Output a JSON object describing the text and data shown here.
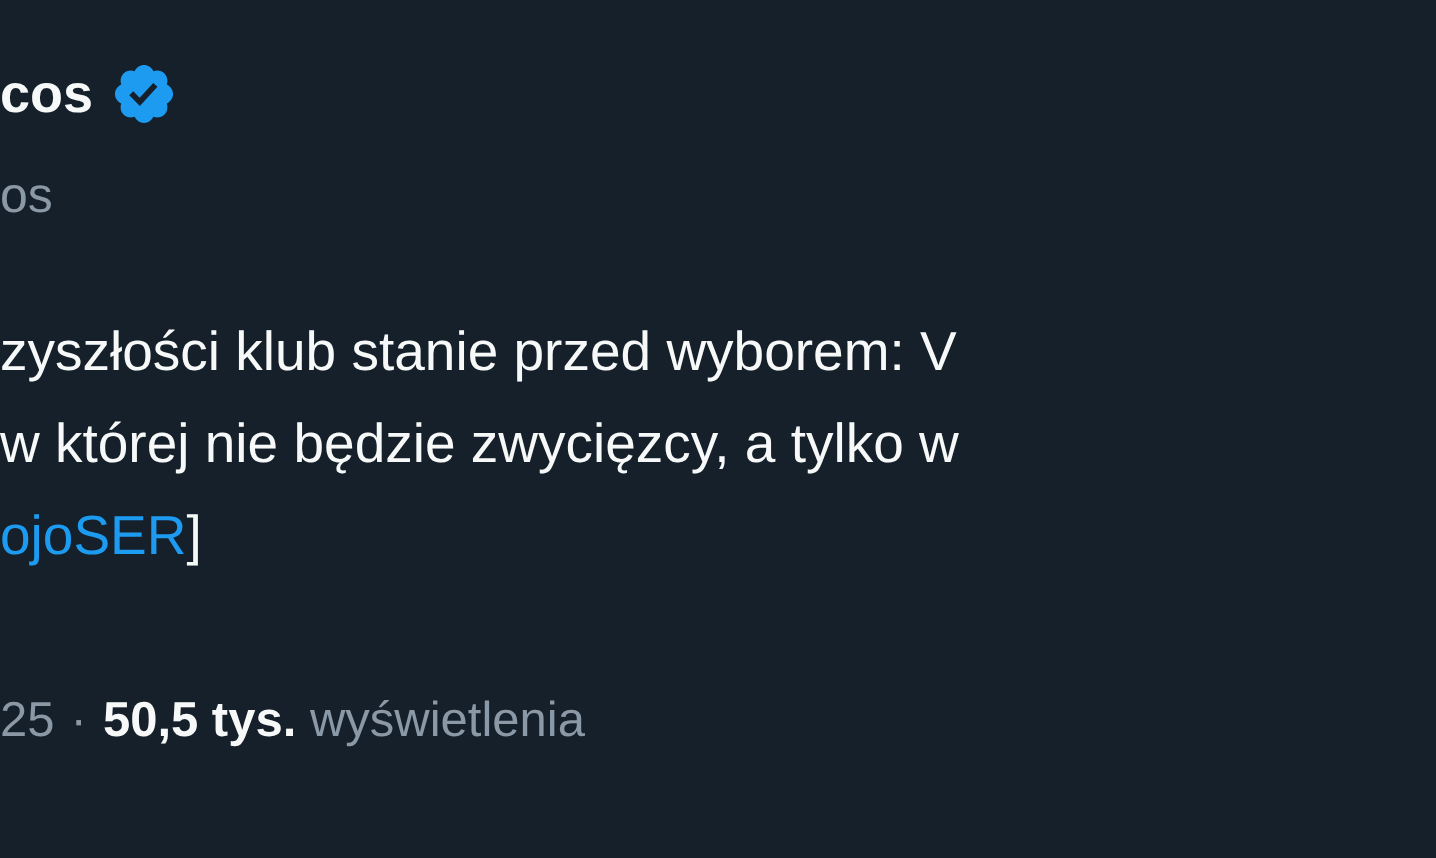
{
  "author": {
    "name": "cos",
    "verified": true,
    "handle": "os"
  },
  "body": {
    "lines": [
      "zyszłości klub stanie przed wyborem: V",
      "w której nie będzie zwycięzcy, a tylko w"
    ],
    "link": "ojoSER",
    "link_after": "]"
  },
  "meta": {
    "date": "25",
    "separator": "·",
    "views_count": "50,5 tys.",
    "views_label": "wyświetlenia"
  }
}
